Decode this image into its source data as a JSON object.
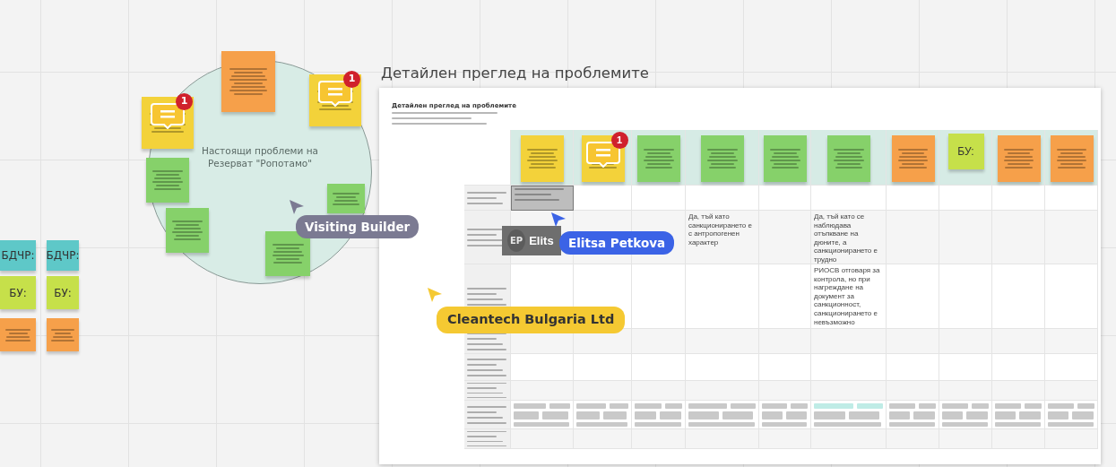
{
  "board_title": "Детайлен преглед на проблемите",
  "circle": {
    "label": "Настоящи проблеми на Резерват \"Ропотамо\""
  },
  "circle_notes": [
    {
      "kind": "unreadable",
      "color": "#f6a04a"
    },
    {
      "kind": "unreadable",
      "color": "#f3d23a",
      "comment": "1"
    },
    {
      "kind": "unreadable",
      "color": "#f3d23a",
      "comment": "1"
    },
    {
      "kind": "unreadable",
      "color": "#86d16a"
    },
    {
      "kind": "unreadable",
      "color": "#86d16a"
    },
    {
      "kind": "unreadable",
      "color": "#86d16a"
    },
    {
      "kind": "unreadable",
      "color": "#86d16a"
    }
  ],
  "side_notes": [
    {
      "kind": "text",
      "text": "БДЧР:",
      "color": "#5ec8c8"
    },
    {
      "kind": "text",
      "text": "БДЧР:",
      "color": "#5ec8c8"
    },
    {
      "kind": "text",
      "text": "БУ:",
      "color": "#c6e04a"
    },
    {
      "kind": "text",
      "text": "БУ:",
      "color": "#c6e04a"
    },
    {
      "kind": "unreadable",
      "color": "#f6a04a"
    },
    {
      "kind": "unreadable",
      "color": "#f6a04a"
    }
  ],
  "frame": {
    "title": "Детайлен преглед на проблемите",
    "table": {
      "columns": [
        {
          "kind": "unreadable",
          "color": "#f3d23a"
        },
        {
          "kind": "unreadable",
          "color": "#f3d23a",
          "comment": "1"
        },
        {
          "kind": "unreadable",
          "color": "#86d16a"
        },
        {
          "kind": "unreadable",
          "color": "#86d16a"
        },
        {
          "kind": "unreadable",
          "color": "#86d16a"
        },
        {
          "kind": "unreadable",
          "color": "#86d16a"
        },
        {
          "kind": "unreadable",
          "color": "#f6a04a"
        },
        {
          "kind": "text",
          "text": "БУ:",
          "color": "#c6e04a"
        },
        {
          "kind": "unreadable",
          "color": "#f6a04a"
        },
        {
          "kind": "unreadable",
          "color": "#f6a04a"
        }
      ],
      "rows": [
        {
          "cells": [
            {
              "kind": "unreadable",
              "highlighted": true
            },
            {
              "kind": "empty"
            },
            {
              "kind": "empty"
            },
            {
              "kind": "empty"
            },
            {
              "kind": "empty"
            },
            {
              "kind": "empty"
            },
            {
              "kind": "empty"
            },
            {
              "kind": "empty"
            },
            {
              "kind": "empty"
            },
            {
              "kind": "empty"
            }
          ]
        },
        {
          "cells": [
            {
              "kind": "empty"
            },
            {
              "kind": "empty"
            },
            {
              "kind": "empty"
            },
            {
              "kind": "text",
              "text": "Да, тъй като санкционирането е с антропогенен характер"
            },
            {
              "kind": "empty"
            },
            {
              "kind": "text",
              "text": "Да, тъй като се наблюдава отъпкване на дюните, а санкционирането е трудно"
            },
            {
              "kind": "empty"
            },
            {
              "kind": "empty"
            },
            {
              "kind": "empty"
            },
            {
              "kind": "empty"
            }
          ]
        },
        {
          "cells": [
            {
              "kind": "empty"
            },
            {
              "kind": "empty"
            },
            {
              "kind": "empty"
            },
            {
              "kind": "empty"
            },
            {
              "kind": "empty"
            },
            {
              "kind": "text",
              "text": "РИОСВ отговаря за контрола, но при нагреждане на документ за санкционност, санкционирането е невъзможно"
            },
            {
              "kind": "empty"
            },
            {
              "kind": "empty"
            },
            {
              "kind": "empty"
            },
            {
              "kind": "empty"
            }
          ]
        },
        {
          "cells": [
            {
              "kind": "empty"
            },
            {
              "kind": "empty"
            },
            {
              "kind": "empty"
            },
            {
              "kind": "empty"
            },
            {
              "kind": "empty"
            },
            {
              "kind": "empty"
            },
            {
              "kind": "empty"
            },
            {
              "kind": "empty"
            },
            {
              "kind": "empty"
            },
            {
              "kind": "empty"
            }
          ]
        },
        {
          "cells": [
            {
              "kind": "empty"
            },
            {
              "kind": "empty"
            },
            {
              "kind": "empty"
            },
            {
              "kind": "empty"
            },
            {
              "kind": "empty"
            },
            {
              "kind": "empty"
            },
            {
              "kind": "empty"
            },
            {
              "kind": "empty"
            },
            {
              "kind": "empty"
            },
            {
              "kind": "empty"
            }
          ]
        },
        {
          "cells": [
            {
              "kind": "empty"
            },
            {
              "kind": "empty"
            },
            {
              "kind": "empty"
            },
            {
              "kind": "empty"
            },
            {
              "kind": "empty"
            },
            {
              "kind": "empty"
            },
            {
              "kind": "empty"
            },
            {
              "kind": "empty"
            },
            {
              "kind": "empty"
            },
            {
              "kind": "empty"
            }
          ]
        },
        {
          "cells": [
            {
              "kind": "tags",
              "color": "#c9c9c9"
            },
            {
              "kind": "tags",
              "color": "#c9c9c9"
            },
            {
              "kind": "tags",
              "color": "#c9c9c9"
            },
            {
              "kind": "tags",
              "color": "#c9c9c9"
            },
            {
              "kind": "tags",
              "color": "#c9c9c9"
            },
            {
              "kind": "tags",
              "color": "#bfece6"
            },
            {
              "kind": "tags",
              "color": "#c9c9c9"
            },
            {
              "kind": "tags",
              "color": "#c9c9c9"
            },
            {
              "kind": "tags",
              "color": "#c9c9c9"
            },
            {
              "kind": "tags",
              "color": "#c9c9c9"
            }
          ]
        },
        {
          "cells": [
            {
              "kind": "empty"
            },
            {
              "kind": "empty"
            },
            {
              "kind": "empty"
            },
            {
              "kind": "empty"
            },
            {
              "kind": "empty"
            },
            {
              "kind": "empty"
            },
            {
              "kind": "empty"
            },
            {
              "kind": "empty"
            },
            {
              "kind": "empty"
            },
            {
              "kind": "empty"
            }
          ]
        }
      ]
    }
  },
  "cursors": [
    {
      "kind": "plain",
      "name": "Visiting Builder",
      "color": "#7b7a92"
    },
    {
      "kind": "tag",
      "initials": "EP",
      "name": "Elits",
      "color": "#6e6e6e"
    },
    {
      "kind": "plain",
      "name": "Elitsa Petkova",
      "color": "#3b63e6"
    },
    {
      "kind": "plain",
      "name": "Cleantech Bulgaria Ltd",
      "color": "#f5c932"
    }
  ]
}
